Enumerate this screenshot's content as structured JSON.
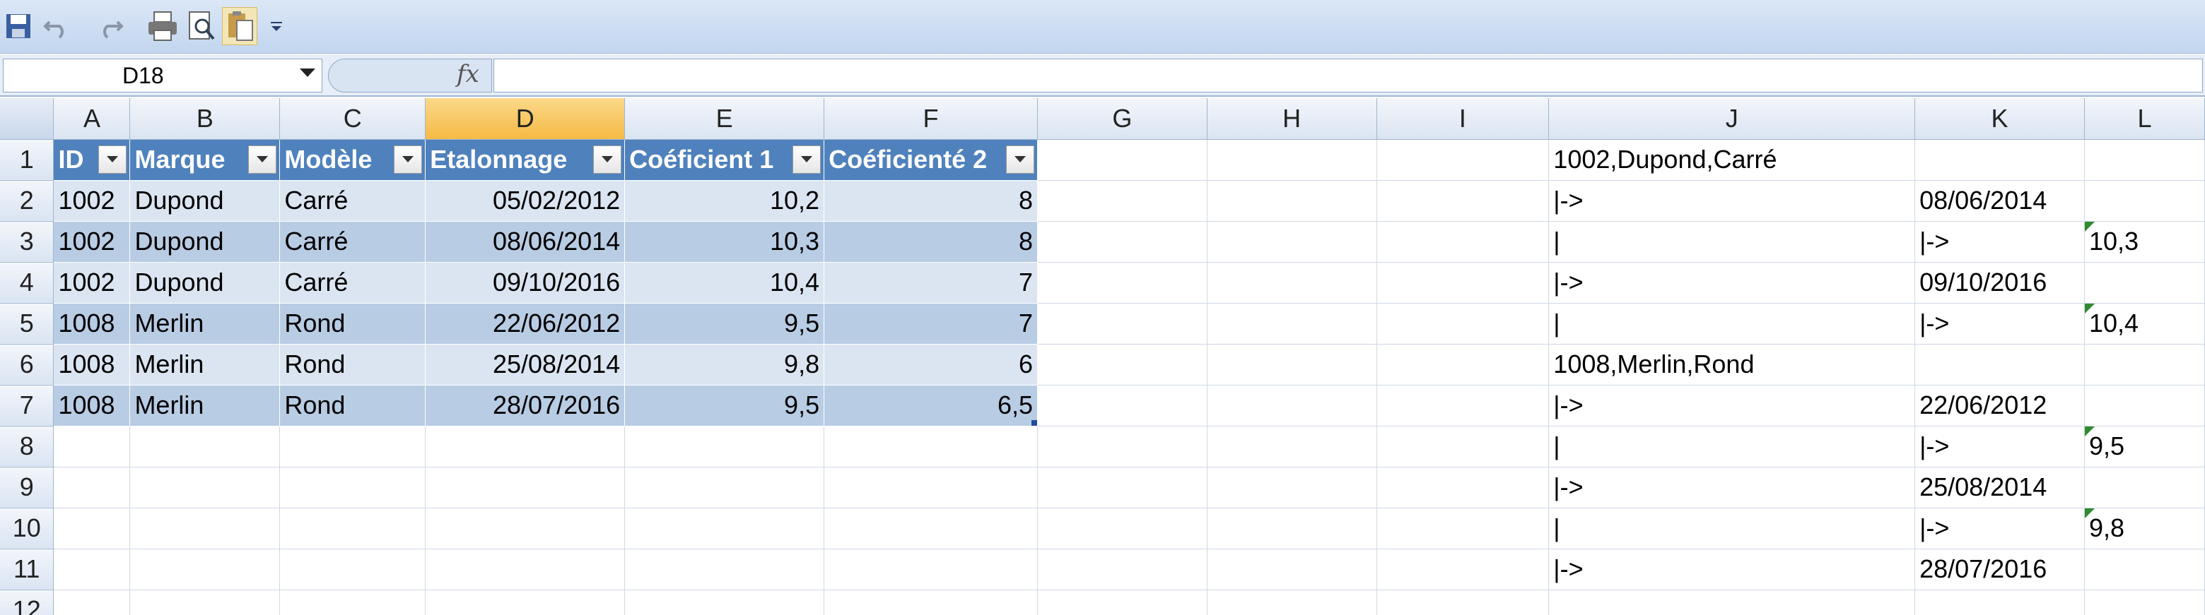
{
  "toolbar": {
    "icons": [
      "save-icon",
      "undo-icon",
      "redo-icon",
      "print-icon",
      "print-preview-icon",
      "paste-icon",
      "customize-dropdown-icon"
    ]
  },
  "formula_bar": {
    "name_box": "D18",
    "fx": "fx",
    "content": ""
  },
  "columns": [
    "A",
    "B",
    "C",
    "D",
    "E",
    "F",
    "G",
    "H",
    "I",
    "J",
    "K",
    "L"
  ],
  "selected_column": "D",
  "rows": [
    "1",
    "2",
    "3",
    "4",
    "5",
    "6",
    "7",
    "8",
    "9",
    "10",
    "11",
    "12"
  ],
  "table": {
    "headers": [
      "ID",
      "Marque",
      "Modèle",
      "Etalonnage",
      "Coéficient 1",
      "Coéficienté 2"
    ],
    "data": [
      [
        "1002",
        "Dupond",
        "Carré",
        "05/02/2012",
        "10,2",
        "8"
      ],
      [
        "1002",
        "Dupond",
        "Carré",
        "08/06/2014",
        "10,3",
        "8"
      ],
      [
        "1002",
        "Dupond",
        "Carré",
        "09/10/2016",
        "10,4",
        "7"
      ],
      [
        "1008",
        "Merlin",
        "Rond",
        "22/06/2012",
        "9,5",
        "7"
      ],
      [
        "1008",
        "Merlin",
        "Rond",
        "25/08/2014",
        "9,8",
        "6"
      ],
      [
        "1008",
        "Merlin",
        "Rond",
        "28/07/2016",
        "9,5",
        "6,5"
      ]
    ]
  },
  "side": [
    {
      "J": "1002,Dupond,Carré",
      "K": "",
      "L": ""
    },
    {
      "J": "|->",
      "K": "08/06/2014",
      "L": ""
    },
    {
      "J": "|",
      "K": "|->",
      "L": "10,3"
    },
    {
      "J": "|->",
      "K": "09/10/2016",
      "L": ""
    },
    {
      "J": "|",
      "K": "|->",
      "L": "10,4"
    },
    {
      "J": "1008,Merlin,Rond",
      "K": "",
      "L": ""
    },
    {
      "J": "|->",
      "K": "22/06/2012",
      "L": ""
    },
    {
      "J": "|",
      "K": "|->",
      "L": "9,5"
    },
    {
      "J": "|->",
      "K": "25/08/2014",
      "L": ""
    },
    {
      "J": "|",
      "K": "|->",
      "L": "9,8"
    },
    {
      "J": "|->",
      "K": "28/07/2016",
      "L": ""
    },
    {
      "J": "",
      "K": "",
      "L": ""
    }
  ]
}
